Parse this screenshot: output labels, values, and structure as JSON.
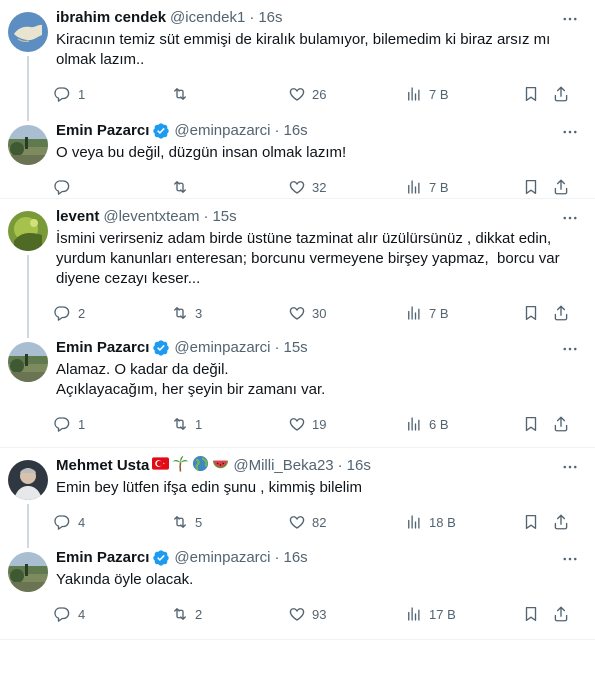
{
  "tweets": [
    {
      "name": "ibrahim cendek",
      "handle": "@icendek1",
      "time": "16s",
      "text": "Kiracının temiz süt emmişi de kiralık bulamıyor, bilemedim ki biraz arsız mı olmak lazım..",
      "verified": false,
      "replies": "1",
      "retweets": "",
      "likes": "26",
      "views": "7 B",
      "avatar": "map-avatar"
    },
    {
      "name": "Emin Pazarcı",
      "handle": "@eminpazarci",
      "time": "16s",
      "text": "O veya bu değil, düzgün insan olmak lazım!",
      "verified": true,
      "replies": "",
      "retweets": "",
      "likes": "32",
      "views": "7 B",
      "avatar": "landscape-avatar"
    },
    {
      "name": "levent",
      "handle": "@leventxteam",
      "time": "15s",
      "text": "İsmini verirseniz adam birde üstüne tazminat alır üzülürsünüz , dikkat edin, yurdum kanunları enteresan; borcunu vermeyene birşey yapmaz,  borcu var diyene cezayı keser...",
      "verified": false,
      "replies": "2",
      "retweets": "3",
      "likes": "30",
      "views": "7 B",
      "avatar": "nature-avatar"
    },
    {
      "name": "Emin Pazarcı",
      "handle": "@eminpazarci",
      "time": "15s",
      "text": "Alamaz. O kadar da değil.\nAçıklayacağım, her şeyin bir zamanı var.",
      "verified": true,
      "replies": "1",
      "retweets": "1",
      "likes": "19",
      "views": "6 B",
      "avatar": "landscape-avatar"
    },
    {
      "name": "Mehmet Usta",
      "handle": "@Milli_Beka23",
      "time": "16s",
      "text": "Emin bey lütfen ifşa edin şunu , kimmiş bilelim",
      "verified": false,
      "replies": "4",
      "retweets": "5",
      "likes": "82",
      "views": "18 B",
      "avatar": "portrait-avatar",
      "emojis": [
        "turkey-flag",
        "palm-tree",
        "globe",
        "watermelon"
      ]
    },
    {
      "name": "Emin Pazarcı",
      "handle": "@eminpazarci",
      "time": "16s",
      "text": "Yakında öyle olacak.",
      "verified": true,
      "replies": "4",
      "retweets": "2",
      "likes": "93",
      "views": "17 B",
      "avatar": "landscape-avatar"
    }
  ],
  "colors": {
    "text": "#0f1419",
    "secondary": "#536471",
    "verified": "#1d9bf0",
    "thread": "#cfd9de",
    "divider": "#eff3f4"
  }
}
